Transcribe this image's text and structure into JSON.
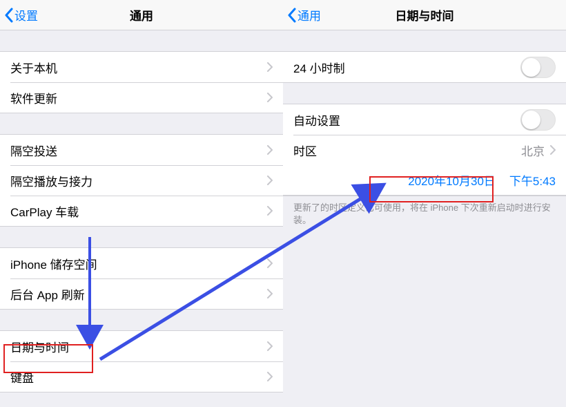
{
  "left": {
    "back_label": "设置",
    "title": "通用",
    "groups": [
      {
        "rows": [
          {
            "label": "关于本机"
          },
          {
            "label": "软件更新"
          }
        ]
      },
      {
        "rows": [
          {
            "label": "隔空投送"
          },
          {
            "label": "隔空播放与接力"
          },
          {
            "label": "CarPlay 车载"
          }
        ]
      },
      {
        "rows": [
          {
            "label": "iPhone 储存空间"
          },
          {
            "label": "后台 App 刷新"
          }
        ]
      },
      {
        "rows": [
          {
            "label": "日期与时间"
          },
          {
            "label": "键盘"
          }
        ]
      }
    ]
  },
  "right": {
    "back_label": "通用",
    "title": "日期与时间",
    "row_24h": "24 小时制",
    "row_auto": "自动设置",
    "row_tz_label": "时区",
    "row_tz_value": "北京",
    "date_value": "2020年10月30日",
    "time_value": "下午5:43",
    "footnote": "更新了的时区定义已可使用，将在 iPhone 下次重新启动时进行安装。"
  }
}
